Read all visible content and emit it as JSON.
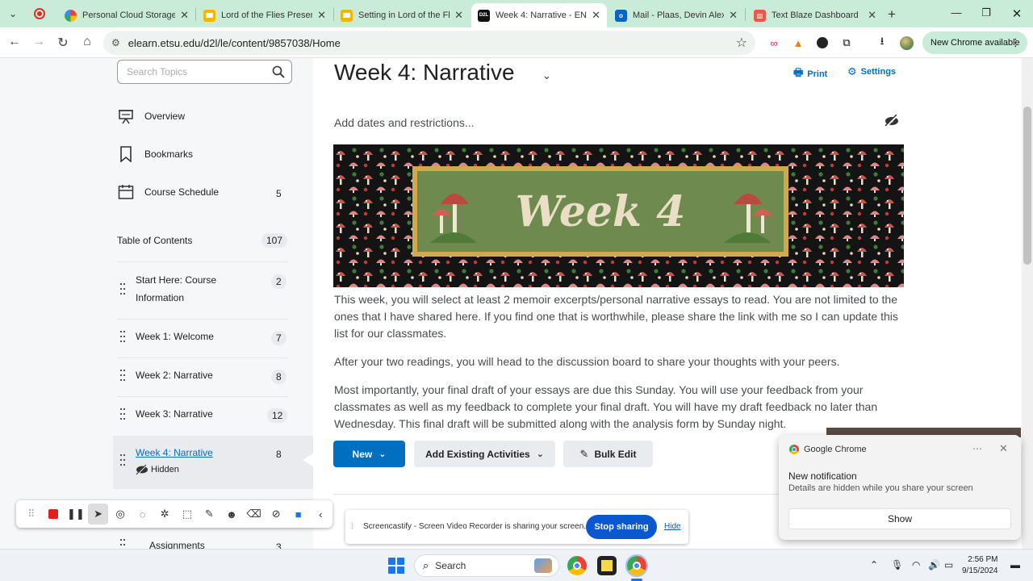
{
  "browser": {
    "tabs": [
      {
        "title": "Personal Cloud Storage &",
        "favicon": "cloud-icon",
        "active": false
      },
      {
        "title": "Lord of the Flies Presenta",
        "favicon": "slides-icon",
        "active": false
      },
      {
        "title": "Setting in Lord of the Flie",
        "favicon": "slides-icon",
        "active": false
      },
      {
        "title": "Week 4: Narrative - ENGL",
        "favicon": "d2l-icon",
        "favicon_text": "D2L",
        "active": true
      },
      {
        "title": "Mail - Plaas, Devin Alexa",
        "favicon": "outlook-icon",
        "active": false
      },
      {
        "title": "Text Blaze Dashboard",
        "favicon": "textblaze-icon",
        "active": false
      }
    ],
    "url": "elearn.etsu.edu/d2l/le/content/9857038/Home",
    "new_chrome_label": "New Chrome available",
    "accent": "#c9ecd9"
  },
  "sidebar": {
    "search_placeholder": "Search Topics",
    "nav": [
      {
        "label": "Overview",
        "icon": "presentation-icon"
      },
      {
        "label": "Bookmarks",
        "icon": "bookmark-icon"
      },
      {
        "label": "Course Schedule",
        "icon": "calendar-icon",
        "count": "5"
      }
    ],
    "toc_label": "Table of Contents",
    "toc_count": "107",
    "modules": [
      {
        "label": "Start Here: Course Information",
        "line1": "Start Here: Course",
        "line2": "Information",
        "count": "2"
      },
      {
        "label": "Week 1: Welcome",
        "count": "7"
      },
      {
        "label": "Week 2: Narrative",
        "count": "8"
      },
      {
        "label": "Week 3: Narrative",
        "count": "12"
      },
      {
        "label": "Week 4: Narrative",
        "count": "8",
        "selected": true,
        "status": "Hidden"
      },
      {
        "label": "Assignments",
        "count": "3"
      }
    ]
  },
  "main": {
    "title": "Week 4: Narrative",
    "print_label": "Print",
    "settings_label": "Settings",
    "dates_label": "Add dates and restrictions...",
    "banner_text": "Week 4",
    "paragraphs": [
      "This week, you will select at least 2 memoir excerpts/personal narrative essays to read. You are not limited to the ones that I have shared here. If you find one that is worthwhile, please share the link with me so I can update this list for our classmates.",
      "After your two readings, you will head to the discussion board to share your thoughts with your peers.",
      "Most importantly, your final draft of your essays are due this Sunday. You will use your feedback from your classmates as well as my feedback to complete your final draft. You will have my draft feedback no later than Wednesday. This final draft will be submitted along with the analysis form by Sunday night."
    ],
    "buttons": {
      "new": "New",
      "add_existing": "Add Existing Activities",
      "bulk_edit": "Bulk Edit"
    },
    "link_color": "#006fbf"
  },
  "screencastify": {
    "sharing_text": "Screencastify - Screen Video Recorder is sharing your screen.",
    "stop_label": "Stop sharing",
    "hide_label": "Hide"
  },
  "notification": {
    "app": "Google Chrome",
    "title": "New notification",
    "body": "Details are hidden while you share your screen",
    "show_label": "Show"
  },
  "taskbar": {
    "search_label": "Search",
    "time": "2:56 PM",
    "date": "9/15/2024"
  }
}
